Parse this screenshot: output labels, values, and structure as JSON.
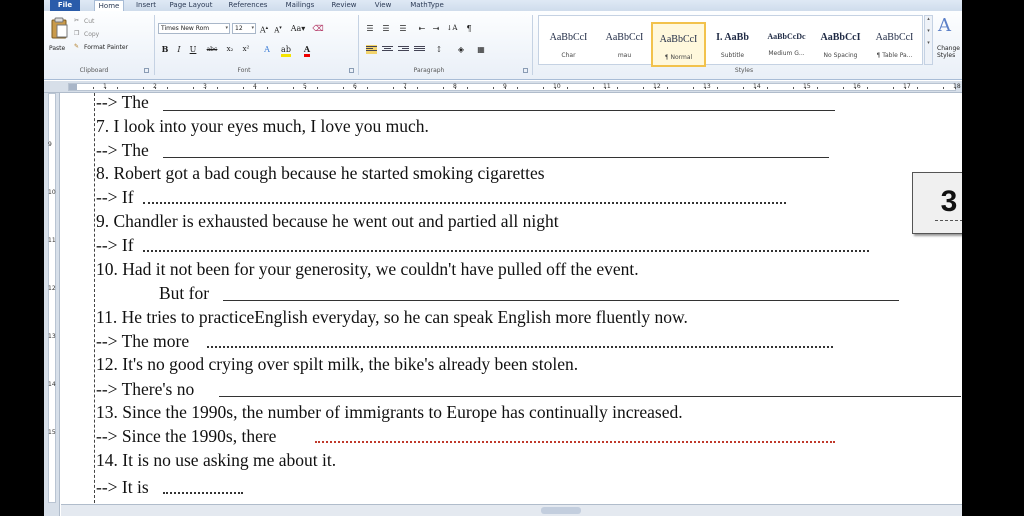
{
  "tabs": [
    "File",
    "Home",
    "Insert",
    "Page Layout",
    "References",
    "Mailings",
    "Review",
    "View",
    "MathType"
  ],
  "clipboard": {
    "paste": "Paste",
    "cut": "Cut",
    "copy": "Copy",
    "format_painter": "Format Painter",
    "label": "Clipboard"
  },
  "font": {
    "name": "Times New Rom",
    "size": "12",
    "label": "Font",
    "buttons": [
      "B",
      "I",
      "U",
      "abc",
      "x₂",
      "x²"
    ]
  },
  "paragraph": {
    "label": "Paragraph"
  },
  "styles": {
    "label": "Styles",
    "items": [
      {
        "sample": "AaBbCcI",
        "name": "Char"
      },
      {
        "sample": "AaBbCcI",
        "name": "mau"
      },
      {
        "sample": "AaBbCcI",
        "name": "¶ Normal"
      },
      {
        "sample": "I. AaBb",
        "name": "Subtitle"
      },
      {
        "sample": "AaBbCcDc",
        "name": "Medium G..."
      },
      {
        "sample": "AaBbCcI",
        "name": "No Spacing"
      },
      {
        "sample": "AaBbCcI",
        "name": "¶ Table Pa..."
      }
    ],
    "change_styles": "Change Styles"
  },
  "colors": {
    "file_tab": "#2a5caa",
    "selected_style": "#f2c24c",
    "red_dots": "#c0392b"
  },
  "document": {
    "lines": [
      {
        "text": "--> The"
      },
      {
        "text": "7. I look into your eyes much, I love you much."
      },
      {
        "text": "--> The"
      },
      {
        "text": "8. Robert got a bad cough because he started smoking cigarettes"
      },
      {
        "text": "--> If"
      },
      {
        "text": "9. Chandler is exhausted because he went out and partied all night"
      },
      {
        "text": "--> If"
      },
      {
        "text": "10. Had it not been for your generosity, we couldn't have pulled off the event."
      },
      {
        "text": "But for"
      },
      {
        "text": "11. He tries to practiceEnglish everyday, so he can speak English more fluently now."
      },
      {
        "text": "--> The more"
      },
      {
        "text": "12. It's no good crying over spilt milk, the bike's already been stolen."
      },
      {
        "text": "--> There's no"
      },
      {
        "text": "13. Since the 1990s, the number of immigrants to Europe has continually increased."
      },
      {
        "text": "--> Since the 1990s, there"
      },
      {
        "text": "14. It is no use asking me about it."
      },
      {
        "text": "--> It is"
      }
    ],
    "page_badge": "3"
  }
}
